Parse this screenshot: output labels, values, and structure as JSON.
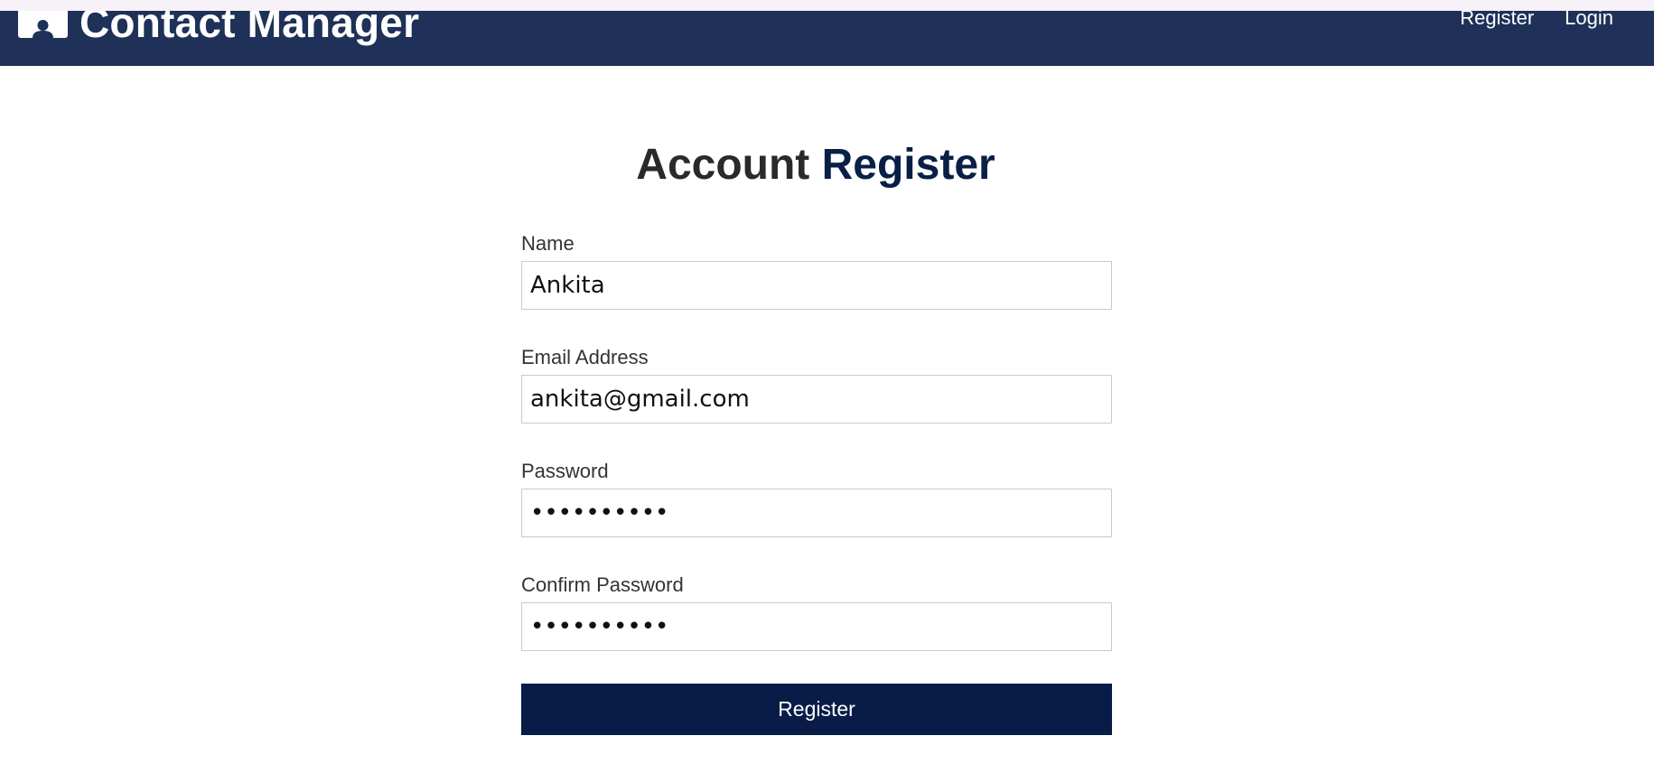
{
  "navbar": {
    "brand_icon": "user-icon",
    "brand_title": "Contact Manager",
    "links": {
      "register": "Register",
      "login": "Login"
    },
    "bg_color": "#1f3158"
  },
  "page": {
    "heading_part1": "Account",
    "heading_part2": "Register"
  },
  "form": {
    "name": {
      "label": "Name",
      "value": "Ankita"
    },
    "email": {
      "label": "Email Address",
      "value": "ankita@gmail.com"
    },
    "password": {
      "label": "Password",
      "value": "••••••••••"
    },
    "confirm_password": {
      "label": "Confirm Password",
      "value": "••••••••••"
    },
    "submit_label": "Register",
    "submit_color": "#081c47"
  }
}
